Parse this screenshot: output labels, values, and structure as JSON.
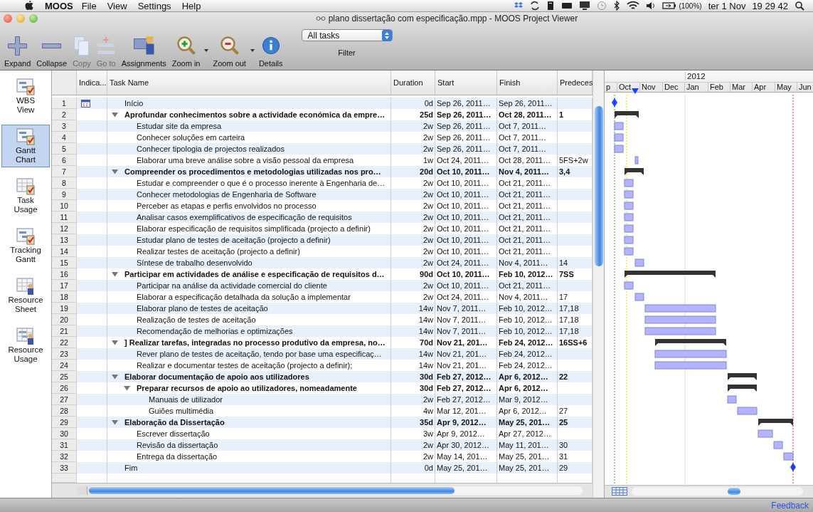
{
  "menubar": {
    "app": "MOOS",
    "menus": [
      "File",
      "View",
      "Settings",
      "Help"
    ],
    "battery": "(100%)",
    "date": "ter 1 Nov",
    "time": "19 29 42"
  },
  "window": {
    "title": "plano dissertação com especificação.mpp - MOOS Project Viewer"
  },
  "toolbar": [
    {
      "label": "Expand",
      "disabled": false
    },
    {
      "label": "Collapse",
      "disabled": false
    },
    {
      "label": "Copy",
      "disabled": true
    },
    {
      "label": "Go to",
      "disabled": true
    },
    {
      "label": "Assignments",
      "disabled": false
    },
    {
      "label": "Zoom in",
      "disabled": false
    },
    {
      "label": "Zoom out",
      "disabled": false
    },
    {
      "label": "Details",
      "disabled": false
    }
  ],
  "filter": {
    "value": "All tasks",
    "label": "Filter"
  },
  "views": [
    {
      "label": "WBS View",
      "selected": false
    },
    {
      "label": "Gantt Chart",
      "selected": true
    },
    {
      "label": "Task Usage",
      "selected": false
    },
    {
      "label": "Tracking Gantt",
      "selected": false
    },
    {
      "label": "Resource Sheet",
      "selected": false
    },
    {
      "label": "Resource Usage",
      "selected": false
    }
  ],
  "table": {
    "columns": [
      "Indica...",
      "Task Name",
      "Duration",
      "Start",
      "Finish",
      "Predeces"
    ],
    "tasks": [
      {
        "num": "1",
        "kind": "milestone",
        "indicator": true,
        "name": "Início",
        "duration": "0d",
        "start": "Sep 26, 2011…",
        "finish": "Sep 26, 2011…"
      },
      {
        "num": "2",
        "kind": "summary",
        "indicator": false,
        "expanded": true,
        "name": "Aprofundar conhecimentos sobre a actividade económica da empre…",
        "duration": "25d",
        "start": "Sep 26, 2011…",
        "finish": "Oct 28, 2011…",
        "predecessors": "1",
        "children": [
          {
            "num": "3",
            "kind": "task",
            "indicator": false,
            "name": "Estudar site da empresa",
            "duration": "2w",
            "start": "Sep 26, 2011…",
            "finish": "Oct 7, 2011…"
          },
          {
            "num": "4",
            "kind": "task",
            "indicator": false,
            "name": "Conhecer soluções em carteira",
            "duration": "2w",
            "start": "Sep 26, 2011…",
            "finish": "Oct 7, 2011…"
          },
          {
            "num": "5",
            "kind": "task",
            "indicator": false,
            "name": "Conhecer tipologia de projectos realizados",
            "duration": "2w",
            "start": "Sep 26, 2011…",
            "finish": "Oct 7, 2011…"
          },
          {
            "num": "6",
            "kind": "task",
            "indicator": false,
            "name": "Elaborar uma breve análise sobre a visão pessoal da empresa",
            "duration": "1w",
            "start": "Oct 24, 2011…",
            "finish": "Oct 28, 2011…",
            "predecessors": "5FS+2w"
          }
        ]
      },
      {
        "num": "7",
        "kind": "summary",
        "indicator": false,
        "expanded": true,
        "name": "Compreender os procedimentos e metodologias utilizadas nos pro…",
        "duration": "20d",
        "start": "Oct 10, 2011…",
        "finish": "Nov 4, 2011…",
        "predecessors": "3,4",
        "children": [
          {
            "num": "8",
            "kind": "task",
            "indicator": false,
            "name": "Estudar e compreender o que é o processo inerente à Engenharia de…",
            "duration": "2w",
            "start": "Oct 10, 2011…",
            "finish": "Oct 21, 2011…"
          },
          {
            "num": "9",
            "kind": "task",
            "indicator": false,
            "name": "Conhecer metodologias de Engenharia de Software",
            "duration": "2w",
            "start": "Oct 10, 2011…",
            "finish": "Oct 21, 2011…"
          },
          {
            "num": "10",
            "kind": "task",
            "indicator": false,
            "name": "Perceber as etapas e perfis envolvidos no processo",
            "duration": "2w",
            "start": "Oct 10, 2011…",
            "finish": "Oct 21, 2011…"
          },
          {
            "num": "11",
            "kind": "task",
            "indicator": false,
            "name": "Analisar casos exemplificativos de especificação de requisitos",
            "duration": "2w",
            "start": "Oct 10, 2011…",
            "finish": "Oct 21, 2011…"
          },
          {
            "num": "12",
            "kind": "task",
            "indicator": false,
            "name": "Elaborar especificação de requisitos simplificada (projecto a definir)",
            "duration": "2w",
            "start": "Oct 10, 2011…",
            "finish": "Oct 21, 2011…"
          },
          {
            "num": "13",
            "kind": "task",
            "indicator": false,
            "name": "Estudar plano de testes de aceitação (projecto a definir)",
            "duration": "2w",
            "start": "Oct 10, 2011…",
            "finish": "Oct 21, 2011…"
          },
          {
            "num": "14",
            "kind": "task",
            "indicator": false,
            "name": "Realizar testes de aceitação (projecto a definir)",
            "duration": "2w",
            "start": "Oct 10, 2011…",
            "finish": "Oct 21, 2011…"
          },
          {
            "num": "15",
            "kind": "task",
            "indicator": false,
            "name": "Síntese de trabalho desenvolvido",
            "duration": "2w",
            "start": "Oct 24, 2011…",
            "finish": "Nov 4, 2011…",
            "predecessors": "14"
          }
        ]
      },
      {
        "num": "16",
        "kind": "summary",
        "indicator": false,
        "expanded": true,
        "name": "Participar em actividades de análise e especificação de requisitos d…",
        "duration": "90d",
        "start": "Oct 10, 2011…",
        "finish": "Feb 10, 2012…",
        "predecessors": "7SS",
        "children": [
          {
            "num": "17",
            "kind": "task",
            "indicator": false,
            "name": "Participar na análise da actividade comercial do cliente",
            "duration": "2w",
            "start": "Oct 10, 2011…",
            "finish": "Oct 21, 2011…"
          },
          {
            "num": "18",
            "kind": "task",
            "indicator": false,
            "name": "Elaborar a especificação detalhada da solução a implementar",
            "duration": "2w",
            "start": "Oct 24, 2011…",
            "finish": "Nov 4, 2011…",
            "predecessors": "17"
          },
          {
            "num": "19",
            "kind": "task",
            "indicator": false,
            "name": "Elaborar plano de testes de aceitação",
            "duration": "14w",
            "start": "Nov 7, 2011…",
            "finish": "Feb 10, 2012…",
            "predecessors": "17,18"
          },
          {
            "num": "20",
            "kind": "task",
            "indicator": false,
            "name": "Realização de testes de aceitação",
            "duration": "14w",
            "start": "Nov 7, 2011…",
            "finish": "Feb 10, 2012…",
            "predecessors": "17,18"
          },
          {
            "num": "21",
            "kind": "task",
            "indicator": false,
            "name": "Recomendação de melhorias e optimizações",
            "duration": "14w",
            "start": "Nov 7, 2011…",
            "finish": "Feb 10, 2012…",
            "predecessors": "17,18"
          }
        ]
      },
      {
        "num": "22",
        "kind": "summary",
        "indicator": false,
        "expanded": true,
        "name": "] Realizar tarefas, integradas no processo produtivo da empresa, no…",
        "duration": "70d",
        "start": "Nov 21, 201…",
        "finish": "Feb 24, 2012…",
        "predecessors": "16SS+6",
        "children": [
          {
            "num": "23",
            "kind": "task",
            "indicator": false,
            "name": "Rever plano de testes de aceitação, tendo por base uma especificaç…",
            "duration": "14w",
            "start": "Nov 21, 201…",
            "finish": "Feb 24, 2012…"
          },
          {
            "num": "24",
            "kind": "task",
            "indicator": false,
            "name": "Realizar e documentar testes de aceitação (projecto a definir);",
            "duration": "14w",
            "start": "Nov 21, 201…",
            "finish": "Feb 24, 2012…"
          }
        ]
      },
      {
        "num": "25",
        "kind": "summary",
        "indicator": false,
        "expanded": true,
        "name": "Elaborar documentação de apoio aos utilizadores",
        "duration": "30d",
        "start": "Feb 27, 2012…",
        "finish": "Apr 6, 2012…",
        "predecessors": "22",
        "children": [
          {
            "num": "26",
            "kind": "summary",
            "indicator": false,
            "expanded": true,
            "name": "Preparar recursos de apoio ao utilizadores, nomeadamente",
            "duration": "30d",
            "start": "Feb 27, 2012…",
            "finish": "Apr 6, 2012…",
            "children": [
              {
                "num": "27",
                "kind": "task",
                "indicator": false,
                "name": "Manuais de utilizador",
                "duration": "2w",
                "start": "Feb 27, 2012…",
                "finish": "Mar 9, 2012…"
              },
              {
                "num": "28",
                "kind": "task",
                "indicator": false,
                "name": "Guiões multimédia",
                "duration": "4w",
                "start": "Mar 12, 201…",
                "finish": "Apr 6, 2012…",
                "predecessors": "27"
              }
            ]
          }
        ]
      },
      {
        "num": "29",
        "kind": "summary",
        "indicator": false,
        "expanded": true,
        "name": "Elaboração da Dissertação",
        "duration": "35d",
        "start": "Apr 9, 2012…",
        "finish": "May 25, 201…",
        "predecessors": "25",
        "children": [
          {
            "num": "30",
            "kind": "task",
            "indicator": false,
            "name": "Escrever dissertação",
            "duration": "3w",
            "start": "Apr 9, 2012…",
            "finish": "Apr 27, 2012…"
          },
          {
            "num": "31",
            "kind": "task",
            "indicator": false,
            "name": "Revisão da dissertação",
            "duration": "2w",
            "start": "Apr 30, 2012…",
            "finish": "May 11, 201…",
            "predecessors": "30"
          },
          {
            "num": "32",
            "kind": "task",
            "indicator": false,
            "name": "Entrega da dissertação",
            "duration": "2w",
            "start": "May 14, 201…",
            "finish": "May 25, 201…",
            "predecessors": "31"
          }
        ]
      },
      {
        "num": "33",
        "kind": "milestone",
        "indicator": false,
        "name": "Fim",
        "duration": "0d",
        "start": "May 25, 201…",
        "finish": "May 25, 201…",
        "predecessors": "29"
      }
    ]
  },
  "gantt": {
    "year": "2012",
    "months": [
      "p",
      "Oct",
      "Nov",
      "Dec",
      "Jan",
      "Feb",
      "Mar",
      "Apr",
      "May",
      "Jun"
    ]
  },
  "footer": {
    "link": "Feedback"
  }
}
